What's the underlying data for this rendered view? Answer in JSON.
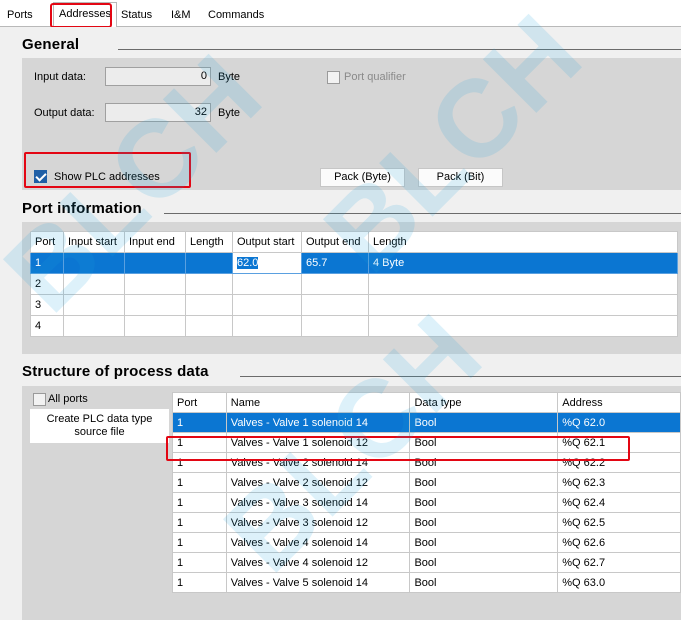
{
  "tabs": [
    {
      "label": "Ports"
    },
    {
      "label": "Addresses"
    },
    {
      "label": "Status"
    },
    {
      "label": "I&M"
    },
    {
      "label": "Commands"
    }
  ],
  "general": {
    "title": "General",
    "input_label": "Input data:",
    "input_value": "0",
    "input_unit": "Byte",
    "output_label": "Output data:",
    "output_value": "32",
    "output_unit": "Byte",
    "port_qualifier_label": "Port qualifier",
    "show_plc_label": "Show PLC addresses",
    "pack_byte_label": "Pack (Byte)",
    "pack_bit_label": "Pack (Bit)"
  },
  "port_info": {
    "title": "Port information",
    "headers": [
      "Port",
      "Input start",
      "Input end",
      "Length",
      "Output start",
      "Output end",
      "Length"
    ],
    "rows": [
      [
        "1",
        "",
        "",
        "",
        "62.0",
        "65.7",
        "4 Byte"
      ],
      [
        "2",
        "",
        "",
        "",
        "",
        "",
        ""
      ],
      [
        "3",
        "",
        "",
        "",
        "",
        "",
        ""
      ],
      [
        "4",
        "",
        "",
        "",
        "",
        "",
        ""
      ]
    ]
  },
  "process": {
    "title": "Structure of process data",
    "all_ports_label": "All ports",
    "create_btn_label": "Create PLC data type source file",
    "headers": [
      "Port",
      "Name",
      "Data type",
      "Address"
    ],
    "rows": [
      [
        "1",
        "Valves - Valve 1 solenoid 14",
        "Bool",
        "%Q 62.0"
      ],
      [
        "1",
        "Valves - Valve 1 solenoid 12",
        "Bool",
        "%Q 62.1"
      ],
      [
        "1",
        "Valves - Valve 2 solenoid 14",
        "Bool",
        "%Q 62.2"
      ],
      [
        "1",
        "Valves - Valve 2 solenoid 12",
        "Bool",
        "%Q 62.3"
      ],
      [
        "1",
        "Valves - Valve 3 solenoid 14",
        "Bool",
        "%Q 62.4"
      ],
      [
        "1",
        "Valves - Valve 3 solenoid 12",
        "Bool",
        "%Q 62.5"
      ],
      [
        "1",
        "Valves - Valve 4 solenoid 14",
        "Bool",
        "%Q 62.6"
      ],
      [
        "1",
        "Valves - Valve 4 solenoid 12",
        "Bool",
        "%Q 62.7"
      ],
      [
        "1",
        "Valves - Valve 5 solenoid 14",
        "Bool",
        "%Q 63.0"
      ]
    ]
  },
  "watermark": "BLCH",
  "colors": {
    "highlight": "#e30613",
    "selection": "#0b76d2",
    "watermark": "#19a3dd"
  }
}
